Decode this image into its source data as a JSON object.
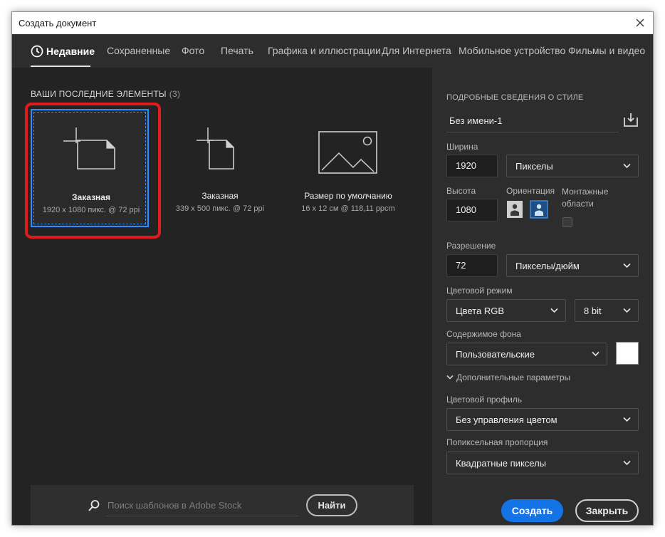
{
  "window": {
    "title": "Создать документ"
  },
  "tabs": [
    {
      "label": "Недавние",
      "active": true,
      "icon": "clock-icon"
    },
    {
      "label": "Сохраненные"
    },
    {
      "label": "Фото"
    },
    {
      "label": "Печать"
    },
    {
      "label": "Графика и иллюстрации"
    },
    {
      "label": "Для Интернета"
    },
    {
      "label": "Мобильное устройство"
    },
    {
      "label": "Фильмы и видео"
    }
  ],
  "recent": {
    "title": "ВАШИ ПОСЛЕДНИЕ ЭЛЕМЕНТЫ",
    "count": "(3)",
    "items": [
      {
        "name": "Заказная",
        "dims": "1920 x 1080 пикс. @ 72 ppi",
        "icon": "landscape-document-icon",
        "selected": true
      },
      {
        "name": "Заказная",
        "dims": "339 x 500 пикс. @ 72 ppi",
        "icon": "portrait-document-icon"
      },
      {
        "name": "Размер по умолчанию",
        "dims": "16 x 12 см @ 118,11 ppcm",
        "icon": "image-placeholder-icon"
      }
    ]
  },
  "search": {
    "placeholder": "Поиск шаблонов в Adobe Stock",
    "button": "Найти"
  },
  "details": {
    "heading": "ПОДРОБНЫЕ СВЕДЕНИЯ О СТИЛЕ",
    "name": "Без имени-1",
    "width_label": "Ширина",
    "width_value": "1920",
    "width_unit": "Пикселы",
    "height_label": "Высота",
    "height_value": "1080",
    "orientation_label": "Ориентация",
    "artboards_label_1": "Монтажные",
    "artboards_label_2": "области",
    "resolution_label": "Разрешение",
    "resolution_value": "72",
    "resolution_unit": "Пикселы/дюйм",
    "color_mode_label": "Цветовой режим",
    "color_mode": "Цвета RGB",
    "bit_depth": "8 bit",
    "background_label": "Содержимое фона",
    "background": "Пользовательские",
    "background_color": "#ffffff",
    "advanced_label": "Дополнительные параметры",
    "color_profile_label": "Цветовой профиль",
    "color_profile": "Без управления цветом",
    "pixel_aspect_label": "Попиксельная пропорция",
    "pixel_aspect": "Квадратные пикселы"
  },
  "actions": {
    "create": "Создать",
    "close": "Закрыть"
  },
  "colors": {
    "accent": "#1473e6",
    "selection": "#2f8eff",
    "highlight": "#e11b1b"
  }
}
